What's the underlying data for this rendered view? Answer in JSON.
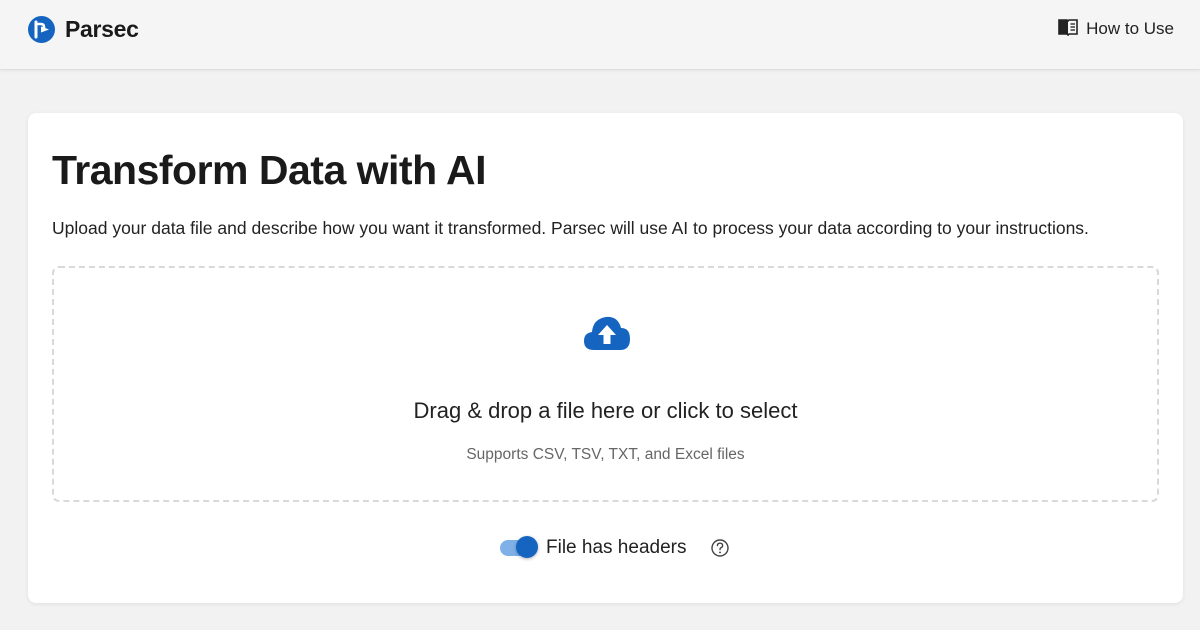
{
  "header": {
    "brand_name": "Parsec",
    "how_to_use_label": "How to Use"
  },
  "main": {
    "title": "Transform Data with AI",
    "description": "Upload your data file and describe how you want it transformed. Parsec will use AI to process your data according to your instructions.",
    "dropzone": {
      "icon": "cloud-upload-icon",
      "title": "Drag & drop a file here or click to select",
      "subtitle": "Supports CSV, TSV, TXT, and Excel files"
    },
    "headers_toggle": {
      "label": "File has headers",
      "checked": true,
      "help_icon": "question-circle-icon"
    }
  },
  "colors": {
    "accent": "#1565c0",
    "accent_light": "#7fb1e8",
    "background": "#f2f2f2",
    "card": "#ffffff"
  }
}
